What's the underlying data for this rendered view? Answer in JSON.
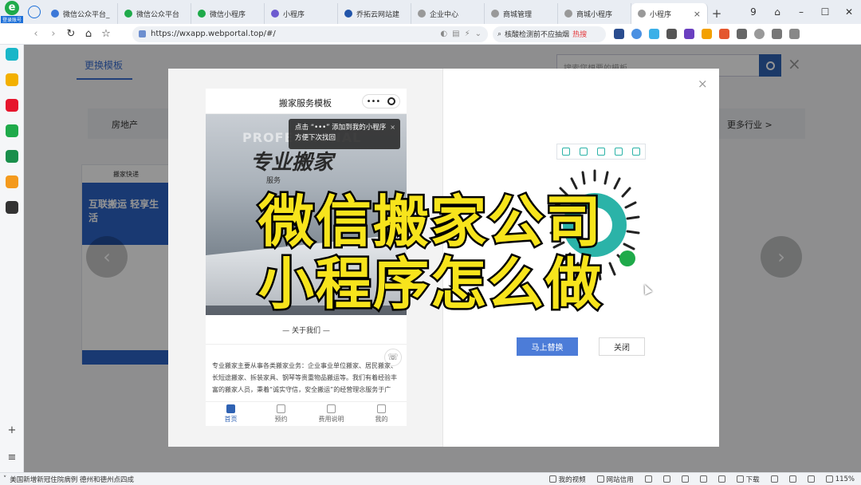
{
  "browser": {
    "logo_label": "登录账号",
    "tabs": [
      {
        "title": "微信公众平台_",
        "color": "#3c78d8"
      },
      {
        "title": "微信公众平台",
        "color": "#1faa4a"
      },
      {
        "title": "微信小程序",
        "color": "#1faa4a"
      },
      {
        "title": "小程序",
        "color": "#6d5bd0"
      },
      {
        "title": "乔拓云网站建",
        "color": "#2255aa"
      },
      {
        "title": "企业中心",
        "color": "#999999"
      },
      {
        "title": "商城管理",
        "color": "#999999"
      },
      {
        "title": "商城小程序",
        "color": "#999999"
      },
      {
        "title": "小程序",
        "color": "#999999",
        "active": true
      }
    ],
    "tab_close": "×",
    "new_tab": "+",
    "window_controls": [
      "9",
      "⌂",
      "–",
      "☐",
      "✕"
    ],
    "url": "https://wxapp.webportal.top/#/",
    "search_text": "核酸检测前不应抽烟",
    "search_badge": "热搜"
  },
  "sidebar": {
    "icons": [
      {
        "name": "plus-app-icon",
        "color": "#19b6c8"
      },
      {
        "name": "star-app-icon",
        "color": "#f3b000"
      },
      {
        "name": "weibo-icon",
        "color": "#e6162d"
      },
      {
        "name": "mail-app-icon",
        "color": "#1faa4a"
      },
      {
        "name": "cloud-app-icon",
        "color": "#1a8f4c"
      },
      {
        "name": "game-app-icon",
        "color": "#f49a1d"
      },
      {
        "name": "panda-app-icon",
        "color": "#333333"
      }
    ],
    "add": "+",
    "menu": "≡"
  },
  "page": {
    "change_template": "更换模板",
    "search_placeholder": "搜索您想要的模板",
    "category_first": "房地产",
    "category_more": "更多行业 >",
    "card_title": "搬家快递",
    "card_banner": "互联搬运 轻享生活",
    "prev": "‹",
    "next": "›"
  },
  "modal": {
    "close": "×",
    "phone": {
      "title": "搬家服务模板",
      "capsule_more": "•••",
      "tooltip_line1": "点击 “•••” 添加到我的小程序",
      "tooltip_line2": "方便下次找回",
      "tooltip_close": "×",
      "hero_watermark": "PROFESSIONAL",
      "hero_title": "专业搬家",
      "hero_sub": "服务",
      "about": "— 关于我们 —",
      "description": "专业搬家主要从事各类搬家业务：企业事业单位搬家、居民搬家、长短途搬家、拆装家具、钢琴等贵重物品搬运等。我们有着经验丰富的搬家人员，秉着“诚实守信，安全搬运”的经营理念服务于广",
      "tabs": [
        {
          "label": "首页",
          "active": true
        },
        {
          "label": "预约",
          "active": false
        },
        {
          "label": "费用说明",
          "active": false
        },
        {
          "label": "我的",
          "active": false
        }
      ]
    },
    "btn_replace": "马上替换",
    "btn_close": "关闭"
  },
  "caption": {
    "line1": "微信搬家公司",
    "line2": "小程序怎么做",
    "color": "#f7e41c"
  },
  "statusbar": {
    "news": "美国新增新冠住院病例 德州和德州点四成",
    "items": [
      "我的视频",
      "网站信用",
      "下载",
      "115%"
    ]
  }
}
